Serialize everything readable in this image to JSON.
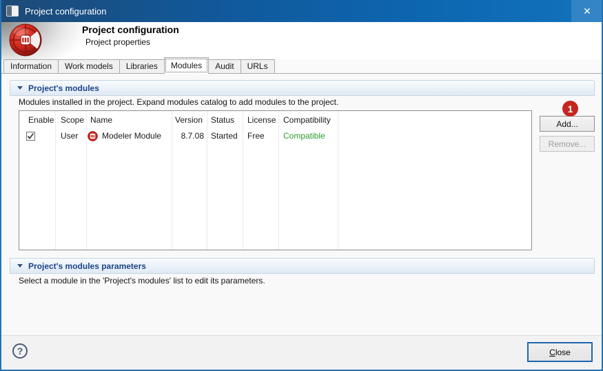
{
  "window": {
    "title": "Project configuration",
    "close_glyph": "✕"
  },
  "header": {
    "title": "Project configuration",
    "subtitle": "Project properties"
  },
  "tabs": [
    {
      "label": "Information",
      "selected": false
    },
    {
      "label": "Work models",
      "selected": false
    },
    {
      "label": "Libraries",
      "selected": false
    },
    {
      "label": "Modules",
      "selected": true
    },
    {
      "label": "Audit",
      "selected": false
    },
    {
      "label": "URLs",
      "selected": false
    }
  ],
  "modules_section": {
    "title": "Project's modules",
    "description": "Modules installed in the project. Expand modules catalog to add modules to the project.",
    "table": {
      "columns": [
        "Enable",
        "Scope",
        "Name",
        "Version",
        "Status",
        "License",
        "Compatibility"
      ],
      "rows": [
        {
          "enabled": true,
          "scope": "User",
          "name": "Modeler Module",
          "version": "8.7.08",
          "status": "Started",
          "license": "Free",
          "compatibility": "Compatible"
        }
      ]
    },
    "add_button": "Add...",
    "remove_button": "Remove...",
    "annotation_badge": "1"
  },
  "parameters_section": {
    "title": "Project's modules parameters",
    "description": "Select a module in the 'Project's modules' list to edit its parameters."
  },
  "footer": {
    "help_glyph": "?",
    "close_button": {
      "mnemonic": "C",
      "rest": "lose"
    }
  },
  "colors": {
    "titlebar_left": "#1d4a76",
    "titlebar_right": "#1272bd",
    "accent_border": "#2173b6",
    "section_title": "#1c4587",
    "compatible_green": "#2f9b2f",
    "badge_red": "#c5261f"
  }
}
